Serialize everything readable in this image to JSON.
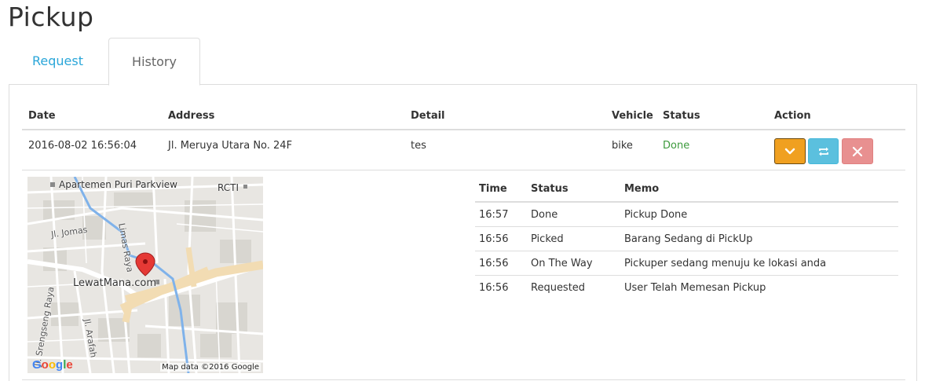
{
  "page": {
    "title": "Pickup"
  },
  "tabs": [
    {
      "label": "Request"
    },
    {
      "label": "History"
    }
  ],
  "table": {
    "headers": [
      "Date",
      "Address",
      "Detail",
      "Vehicle",
      "Status",
      "Action"
    ],
    "row": {
      "date": "2016-08-02 16:56:04",
      "address": "Jl. Meruya Utara No. 24F",
      "detail": "tes",
      "vehicle": "bike",
      "status": "Done"
    },
    "actions": [
      "chevron-down-icon",
      "refresh-icon",
      "close-icon"
    ]
  },
  "map": {
    "labels": [
      "Apartemen Puri Parkview",
      "RCTI",
      "Jl. Jomas",
      "Limas Raya",
      "LewatMana.com",
      "Jl. Srengseng Raya",
      "Jl. Arafah"
    ],
    "logo": "Google",
    "credit": "Map data ©2016 Google"
  },
  "history": {
    "headers": [
      "Time",
      "Status",
      "Memo"
    ],
    "rows": [
      {
        "time": "16:57",
        "status": "Done",
        "memo": "Pickup Done"
      },
      {
        "time": "16:56",
        "status": "Picked",
        "memo": "Barang Sedang di PickUp"
      },
      {
        "time": "16:56",
        "status": "On The Way",
        "memo": "Pickuper sedang menuju ke lokasi anda"
      },
      {
        "time": "16:56",
        "status": "Requested",
        "memo": "User Telah Memesan Pickup"
      }
    ]
  },
  "colors": {
    "accent": "#2aa6d9",
    "status_done": "#3c9a3c",
    "btn_expand": "#f0a020",
    "btn_refresh": "#5bc0de",
    "btn_delete": "#e89090"
  }
}
